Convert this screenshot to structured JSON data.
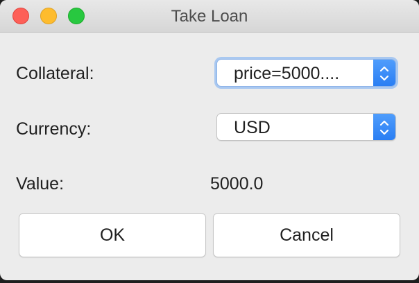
{
  "window": {
    "title": "Take Loan"
  },
  "form": {
    "collateral_label": "Collateral:",
    "collateral_value": "price=5000....",
    "currency_label": "Currency:",
    "currency_value": "USD",
    "value_label": "Value:",
    "value_amount": "5000.0"
  },
  "buttons": {
    "ok": "OK",
    "cancel": "Cancel"
  },
  "colors": {
    "accent": "#2a7ef3",
    "close": "#fd5f57",
    "minimize": "#febc2e",
    "maximize": "#28c840"
  },
  "icons": {
    "close": "close-icon",
    "minimize": "minimize-icon",
    "maximize": "maximize-icon",
    "stepper": "chevron-up-down-icon"
  }
}
